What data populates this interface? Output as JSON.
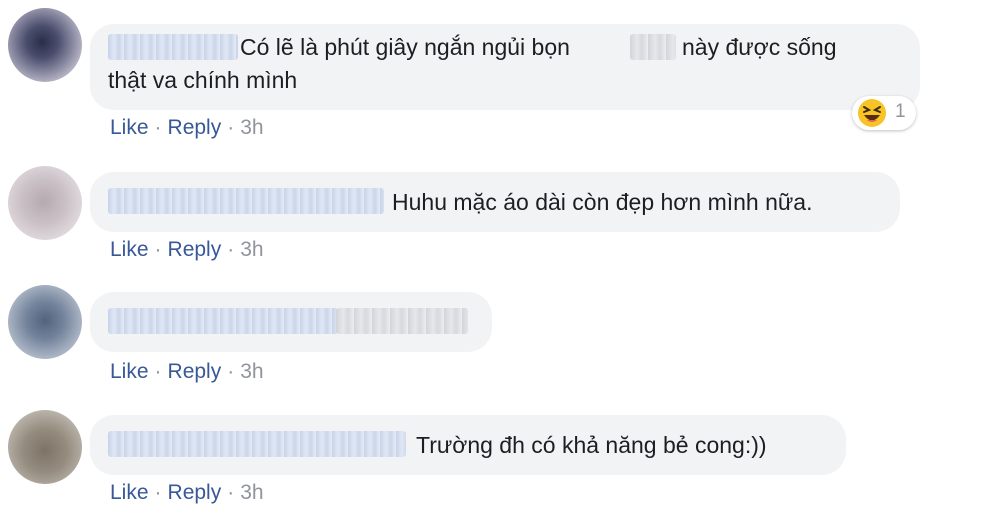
{
  "comments": [
    {
      "text_line1": "Có lẽ là phút giây ngắn ngủi bọn",
      "text_line1b": "này được sống",
      "text_line2": "thật va chính mình",
      "like_label": "Like",
      "reply_label": "Reply",
      "separator": "·",
      "time": "3h",
      "reaction": {
        "icon": "laughing-emoji",
        "count": "1"
      }
    },
    {
      "text": "Huhu mặc áo dài còn đẹp hơn mình nữa.",
      "like_label": "Like",
      "reply_label": "Reply",
      "separator": "·",
      "time": "3h"
    },
    {
      "text": "",
      "like_label": "Like",
      "reply_label": "Reply",
      "separator": "·",
      "time": "3h"
    },
    {
      "text": "Trường đh có khả năng bẻ cong:))",
      "like_label": "Like",
      "reply_label": "Reply",
      "separator": "·",
      "time": "3h"
    }
  ],
  "colors": {
    "bubble": "#f2f3f5",
    "link": "#385898",
    "meta": "#90949c",
    "text": "#1c1e21"
  }
}
